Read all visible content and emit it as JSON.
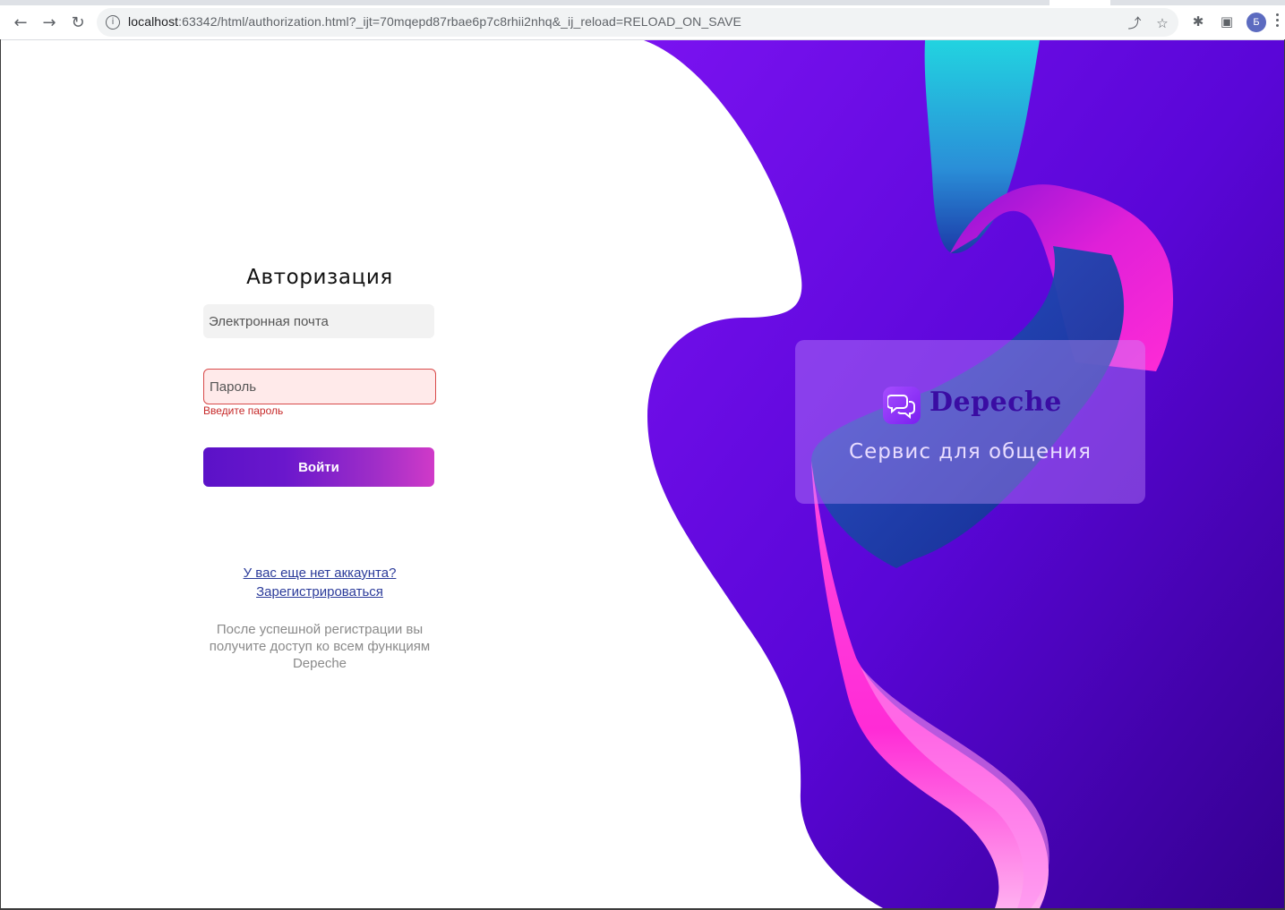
{
  "browser": {
    "url_host": "localhost",
    "url_rest": ":63342/html/authorization.html?_ijt=70mqepd87rbae6p7c8rhii2nhq&_ij_reload=RELOAD_ON_SAVE",
    "profile_initial": "Б",
    "icons": {
      "back": "arrow-left-icon",
      "forward": "arrow-right-icon",
      "reload": "reload-icon",
      "info": "info-icon",
      "share": "share-icon",
      "bookmark": "star-icon",
      "extensions": "puzzle-icon",
      "sidepanel": "side-panel-icon",
      "menu": "kebab-menu-icon"
    }
  },
  "auth": {
    "title": "Авторизация",
    "email_placeholder": "Электронная почта",
    "email_value": "",
    "password_placeholder": "Пароль",
    "password_value": "",
    "password_error": "Введите пароль",
    "login_label": "Войти",
    "no_account_link": "У вас еще нет аккаунта?",
    "register_link": "Зарегистрироваться",
    "register_note": "После успешной регистрации вы получите доступ ко всем функциям Depeche"
  },
  "brand": {
    "name": "Depeche",
    "slogan": "Сервис для общения",
    "logo_icon": "chat-bubbles-icon"
  },
  "colors": {
    "accent_purple": "#5b12c8",
    "accent_pink": "#d03ac8",
    "error_red": "#c62828",
    "link_blue": "#2b3b9a",
    "art_purple": "#6a00e0",
    "art_pink": "#ff2bd6",
    "art_teal": "#23c6d9"
  }
}
